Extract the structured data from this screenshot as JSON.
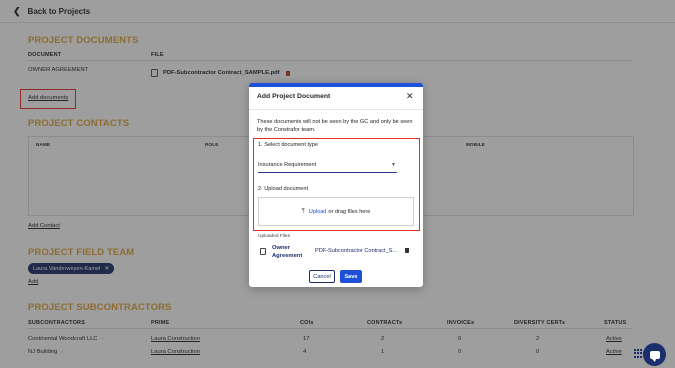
{
  "nav": {
    "back_label": "Back to Projects"
  },
  "documents": {
    "title": "PROJECT DOCUMENTS",
    "col_document": "DOCUMENT",
    "col_file": "FILE",
    "row_document": "OWNER AGREEMENT",
    "row_file": "PDF-Subcontractor Contract_SAMPLE.pdf",
    "add_link": "Add documents"
  },
  "contacts": {
    "title": "PROJECT CONTACTS",
    "col_name": "NAME",
    "col_role": "ROLE",
    "col_mobile": "MOBILE",
    "add_link": "Add Contact"
  },
  "field_team": {
    "title": "PROJECT FIELD TEAM",
    "member": "Laura Vanderweyen-Kamel",
    "add_link": "Add"
  },
  "subcontractors": {
    "title": "PROJECT SUBCONTRACTORS",
    "headers": [
      "SUBCONTRACTORS",
      "PRIME",
      "COIs",
      "CONTRACTs",
      "INVOICEs",
      "DIVERSITY CERTs",
      "STATUS"
    ],
    "rows": [
      {
        "name": "Continental Woodcraft LLC",
        "prime": "Laura Construction",
        "cois": "17",
        "contracts": "2",
        "invoices": "0",
        "diversity": "2",
        "status": "Active"
      },
      {
        "name": "NJ Building",
        "prime": "Laura Construction",
        "cois": "4",
        "contracts": "1",
        "invoices": "0",
        "diversity": "0",
        "status": "Active"
      }
    ]
  },
  "modal": {
    "title": "Add Project Document",
    "note": "These documents will not be seen by the GC and only be seen by the Constrafor team.",
    "step1_label": "1. Select document type",
    "select_value": "Insurance Requirement",
    "step2_label": "2. Upload document",
    "upload_link": "Upload",
    "upload_rest": "or drag files here",
    "uploaded_label": "Uploaded Files",
    "uploaded_name": "Owner Agreement",
    "uploaded_file": "PDF-Subcontractor Contract_S...",
    "cancel_label": "Cancel",
    "save_label": "Save"
  },
  "colors": {
    "accent": "#1d4fd8",
    "section_title": "#e0a43a",
    "highlight": "#e2312a",
    "navy": "#1a2f6b"
  }
}
